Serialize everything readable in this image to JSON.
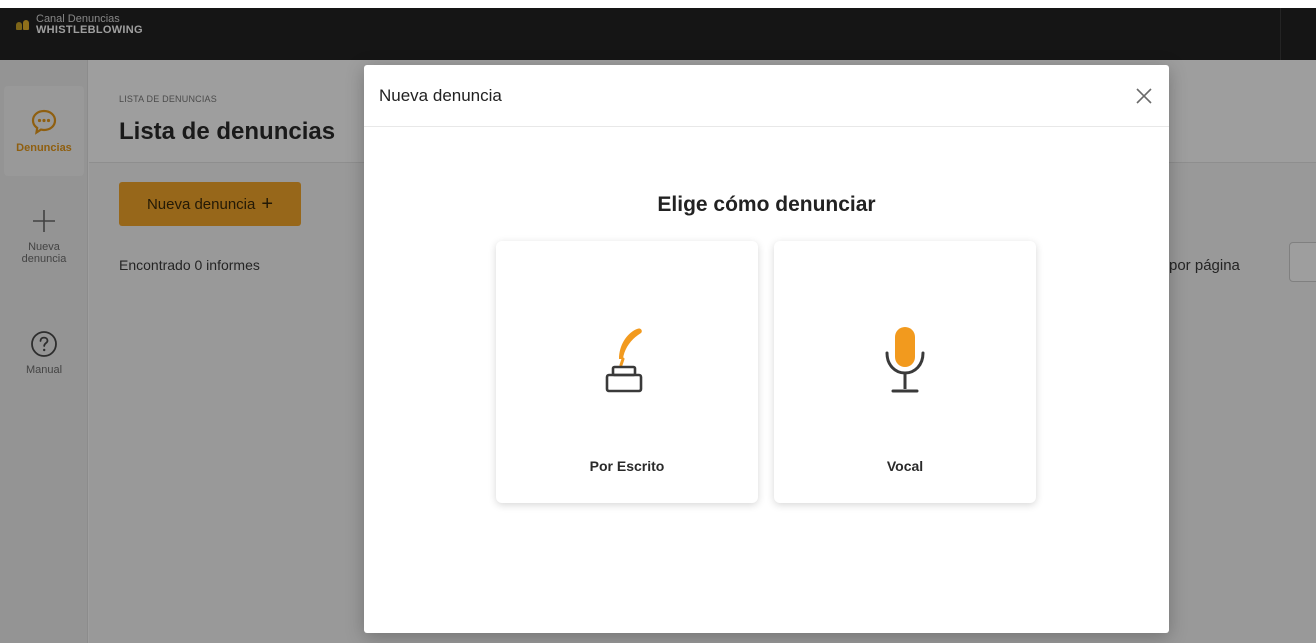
{
  "app": {
    "logo_line1": "Canal Denuncias",
    "logo_line2": "WHISTLEBLOWING"
  },
  "sidebar": {
    "items": [
      {
        "label": "Denuncias",
        "icon": "chat-bubble-icon",
        "active": true
      },
      {
        "label": "Nueva denuncia",
        "icon": "plus-icon",
        "active": false
      },
      {
        "label": "Manual",
        "icon": "help-circle-icon",
        "active": false
      }
    ]
  },
  "page": {
    "breadcrumb": "LISTA DE DENUNCIAS",
    "title": "Lista de denuncias",
    "new_button_label": "Nueva denuncia",
    "new_button_icon": "+",
    "found_text": "Encontrado 0 informes",
    "per_page_label": "por página"
  },
  "modal": {
    "title": "Nueva denuncia",
    "heading": "Elige cómo denunciar",
    "options": [
      {
        "label": "Por Escrito",
        "icon": "quill-inkwell-icon"
      },
      {
        "label": "Vocal",
        "icon": "microphone-icon"
      }
    ]
  },
  "colors": {
    "accent": "#f4a72b",
    "topbar": "#232323",
    "overlay": "rgba(0,0,0,0.38)"
  }
}
